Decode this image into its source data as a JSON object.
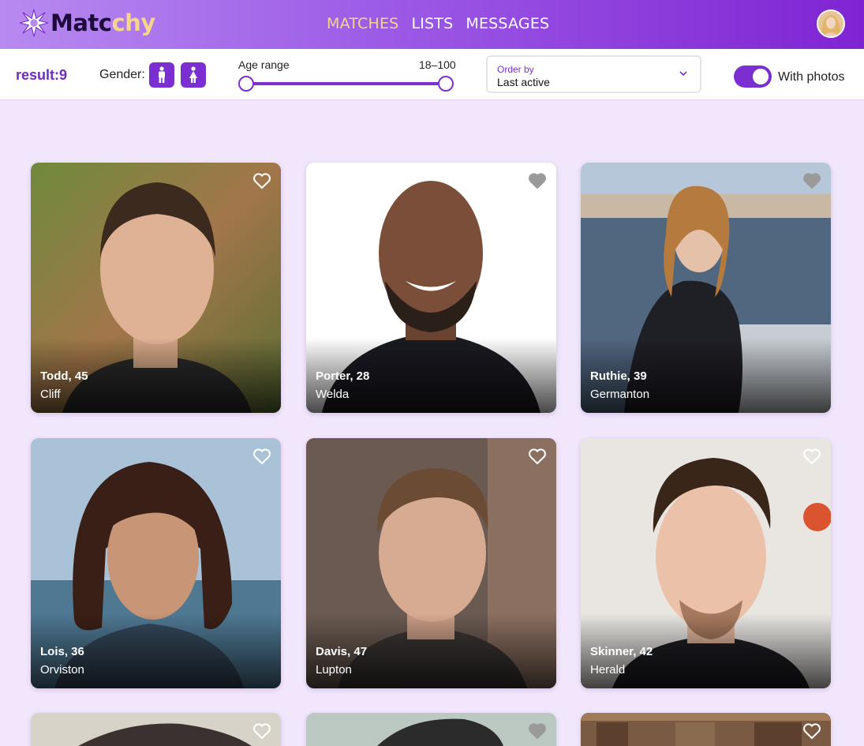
{
  "app": {
    "logo_part1": "Matc",
    "logo_part2": "chy",
    "nav": [
      {
        "label": "MATCHES",
        "active": true
      },
      {
        "label": "LISTS",
        "active": false
      },
      {
        "label": "MESSAGES",
        "active": false
      }
    ]
  },
  "filters": {
    "result": "result:9",
    "gender_label": "Gender:",
    "gender_options": [
      "male-icon",
      "female-icon"
    ],
    "age_label": "Age range",
    "age_value": "18–100",
    "age_min": 18,
    "age_max": 100,
    "order_caption": "Order by",
    "order_value": "Last active",
    "with_photos_label": "With photos",
    "with_photos_on": true
  },
  "profiles": [
    {
      "name": "Todd, 45",
      "city": "Cliff"
    },
    {
      "name": "Porter, 28",
      "city": "Welda"
    },
    {
      "name": "Ruthie, 39",
      "city": "Germanton"
    },
    {
      "name": "Lois, 36",
      "city": "Orviston"
    },
    {
      "name": "Davis, 47",
      "city": "Lupton"
    },
    {
      "name": "Skinner, 42",
      "city": "Herald"
    },
    {
      "name": "",
      "city": ""
    },
    {
      "name": "",
      "city": ""
    },
    {
      "name": "",
      "city": ""
    }
  ],
  "colors": {
    "accent": "#7b2fd0",
    "nav_active": "#f6d58b",
    "background": "#f1e6fb"
  }
}
